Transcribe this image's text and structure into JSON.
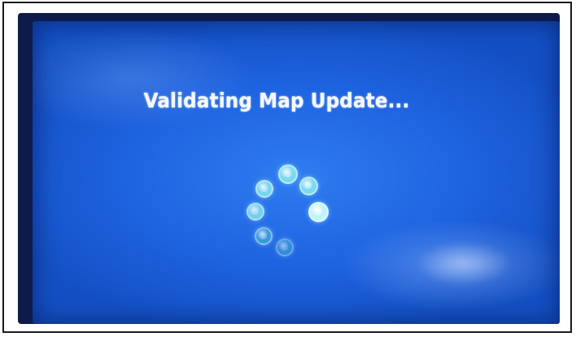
{
  "screen": {
    "message": "Validating Map Update...",
    "spinner": {
      "icon": "loading-spinner-icon",
      "dot_count": 7,
      "colors": {
        "bright": "#bff3ff",
        "medium": "#7fe0f2",
        "faded": "#3fa9d8"
      }
    }
  }
}
